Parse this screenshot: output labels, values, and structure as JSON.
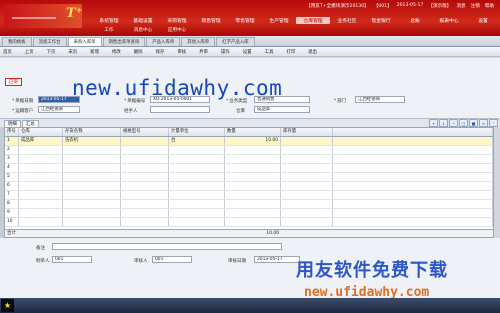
{
  "app": {
    "logo_mark": "T⁺",
    "system_info": [
      "【用友T+全模块演示20130】",
      "【001】",
      "2013-05-17",
      "【演示版】",
      "消息",
      "注销",
      "帮助"
    ],
    "main_nav": [
      "系统管理",
      "基础设置",
      "采购管理",
      "销售管理",
      "零售管理",
      "生产管理",
      "仓库管理",
      "业务社区",
      "现金银行",
      "总账",
      "报表中心",
      "设置"
    ],
    "main_nav_active": 6,
    "sub_nav": [
      "工作",
      "消息中心",
      "应用中心"
    ]
  },
  "tabs": [
    "我的桃板",
    "流程工作台",
    "采购入库单",
    "销售出库单查询",
    "产品入库单",
    "其他入库单",
    "红字产品入库"
  ],
  "active_tab": 2,
  "toolbar": [
    "首页",
    "上页",
    "下页",
    "末页",
    "新增",
    "修改",
    "删除",
    "保存",
    "审核",
    "弃审",
    "操作",
    "设置",
    "工具",
    "打印",
    "退出"
  ],
  "form": {
    "status": "已审",
    "watermark": "new.ufidawhy.com",
    "fields": {
      "doc_date_label": "单据日期",
      "doc_date": "2013-05-17",
      "doc_no_label": "单据编号",
      "doc_no": "XO-2013-05-0001",
      "biz_type_label": "业务类型",
      "biz_type": "普通销售",
      "dept_label": "部门",
      "dept": "江西经销商",
      "customer_label": "运输客户",
      "customer": "江西经销商",
      "handler_label": "经手人",
      "handler": "",
      "warehouse_label": "仓库",
      "warehouse": "成品库"
    }
  },
  "detail": {
    "tabs": [
      "明细",
      "汇总"
    ],
    "icons": [
      "add-row-icon",
      "insert-row-icon",
      "delete-row-icon",
      "copy-icon",
      "paste-icon",
      "batch-icon",
      "more-icon"
    ],
    "columns": [
      "序号",
      "仓库",
      "存货名称",
      "规格型号",
      "计量单位",
      "数量",
      "库存量"
    ],
    "rows": [
      [
        "1",
        "成品库",
        "洗衣机",
        "",
        "台",
        "10.00",
        ""
      ],
      [
        "2",
        "",
        "",
        "",
        "",
        "",
        ""
      ],
      [
        "3",
        "",
        "",
        "",
        "",
        "",
        ""
      ],
      [
        "4",
        "",
        "",
        "",
        "",
        "",
        ""
      ],
      [
        "5",
        "",
        "",
        "",
        "",
        "",
        ""
      ],
      [
        "6",
        "",
        "",
        "",
        "",
        "",
        ""
      ],
      [
        "7",
        "",
        "",
        "",
        "",
        "",
        ""
      ],
      [
        "8",
        "",
        "",
        "",
        "",
        "",
        ""
      ],
      [
        "9",
        "",
        "",
        "",
        "",
        "",
        ""
      ],
      [
        "10",
        "",
        "",
        "",
        "",
        "",
        ""
      ]
    ],
    "total_label": "合计",
    "total_qty": "10.00"
  },
  "footer": {
    "note_label": "备注",
    "maker_label": "制单人",
    "maker": "001",
    "approver_label": "审核人",
    "approver": "001",
    "approve_date_label": "审核日期",
    "approve_date": "2013-05-17"
  },
  "branding": {
    "cn": "用友软件免费下载",
    "url": "new.ufidawhy.com"
  },
  "taskbar": {
    "start_icon": "★"
  }
}
